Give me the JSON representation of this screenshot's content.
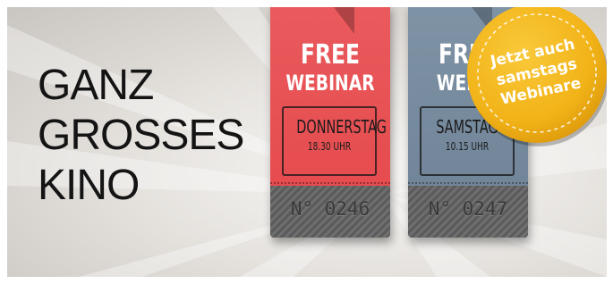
{
  "banner": {
    "headline": [
      "GANZ",
      "GROSSES",
      "KINO"
    ]
  },
  "tickets": [
    {
      "free": "FREE",
      "webinar": "WEBINAR",
      "day": "DONNERSTAG",
      "time": "18.30 UHR",
      "number": "N° 0246",
      "color": "#e4484b"
    },
    {
      "free": "FREE",
      "webinar": "WEBIN",
      "day": "SAMSTAG",
      "time": "10.15 UHR",
      "number": "N° 0247",
      "color": "#6e8195"
    }
  ],
  "badge": {
    "lines": [
      "Jetzt auch",
      "samstags",
      "Webinare"
    ],
    "color": "#f2b318"
  }
}
